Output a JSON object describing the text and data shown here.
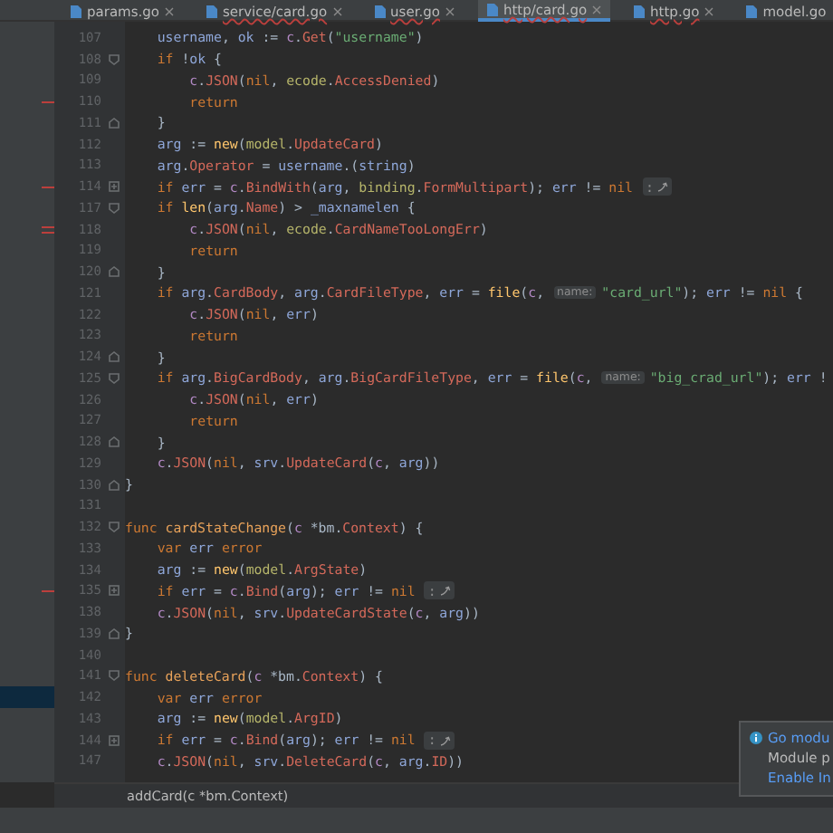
{
  "tabs": [
    {
      "label": "params.go",
      "selected": false,
      "error": false,
      "closable": true
    },
    {
      "label": "service/card.go",
      "selected": false,
      "error": true,
      "closable": true
    },
    {
      "label": "user.go",
      "selected": false,
      "error": true,
      "closable": true
    },
    {
      "label": "http/card.go",
      "selected": true,
      "error": true,
      "closable": true
    },
    {
      "label": "http.go",
      "selected": false,
      "error": true,
      "closable": true
    },
    {
      "label": "model.go",
      "selected": false,
      "error": false,
      "closable": false
    }
  ],
  "lines": [
    {
      "children": [
        {
          "number": "107",
          "kind": "plain",
          "changed": false,
          "double": false,
          "panel_selected": false,
          "segments": [
            {
              "kind": "code",
              "tokens": [
                {
                  "kind": "variable",
                  "text": "username"
                },
                {
                  "kind": "plain",
                  "text": ", "
                },
                {
                  "kind": "variable",
                  "text": "ok"
                },
                {
                  "kind": "plain",
                  "text": " := "
                },
                {
                  "kind": "param",
                  "text": "c"
                },
                {
                  "kind": "plain",
                  "text": "."
                },
                {
                  "kind": "member",
                  "text": "Get"
                },
                {
                  "kind": "plain",
                  "text": "("
                },
                {
                  "kind": "string",
                  "text": "\"username\""
                },
                {
                  "kind": "plain",
                  "text": ")"
                }
              ]
            }
          ]
        },
        {
          "number": "108",
          "kind": "fold_start",
          "changed": false,
          "double": false,
          "panel_selected": false,
          "segments": [
            {
              "kind": "code",
              "tokens": [
                {
                  "kind": "keyword",
                  "text": "if "
                },
                {
                  "kind": "plain",
                  "text": "!"
                },
                {
                  "kind": "variable",
                  "text": "ok"
                },
                {
                  "kind": "plain",
                  "text": " {"
                }
              ]
            }
          ],
          "children": [
            {
              "number": "109",
              "kind": "plain",
              "changed": false,
              "double": false,
              "panel_selected": false,
              "segments": [
                {
                  "kind": "code",
                  "tokens": [
                    {
                      "kind": "param",
                      "text": "c"
                    },
                    {
                      "kind": "plain",
                      "text": "."
                    },
                    {
                      "kind": "member",
                      "text": "JSON"
                    },
                    {
                      "kind": "plain",
                      "text": "("
                    },
                    {
                      "kind": "keyword",
                      "text": "nil"
                    },
                    {
                      "kind": "plain",
                      "text": ", "
                    },
                    {
                      "kind": "package",
                      "text": "ecode"
                    },
                    {
                      "kind": "plain",
                      "text": "."
                    },
                    {
                      "kind": "member",
                      "text": "AccessDenied"
                    },
                    {
                      "kind": "plain",
                      "text": ")"
                    }
                  ]
                }
              ]
            },
            {
              "number": "110",
              "kind": "plain",
              "changed": true,
              "double": false,
              "panel_selected": false,
              "segments": [
                {
                  "kind": "code",
                  "tokens": [
                    {
                      "kind": "keyword",
                      "text": "return"
                    }
                  ]
                }
              ]
            }
          ]
        },
        {
          "number": "111",
          "kind": "fold_end",
          "changed": false,
          "double": false,
          "panel_selected": false,
          "segments": [
            {
              "kind": "code",
              "tokens": [
                {
                  "kind": "plain",
                  "text": "}"
                }
              ]
            }
          ]
        },
        {
          "number": "112",
          "kind": "plain",
          "changed": false,
          "double": false,
          "panel_selected": false,
          "segments": [
            {
              "kind": "code",
              "tokens": [
                {
                  "kind": "variable",
                  "text": "arg"
                },
                {
                  "kind": "plain",
                  "text": " := "
                },
                {
                  "kind": "builtin",
                  "text": "new"
                },
                {
                  "kind": "plain",
                  "text": "("
                },
                {
                  "kind": "package",
                  "text": "model"
                },
                {
                  "kind": "plain",
                  "text": "."
                },
                {
                  "kind": "member",
                  "text": "UpdateCard"
                },
                {
                  "kind": "plain",
                  "text": ")"
                }
              ]
            }
          ]
        },
        {
          "number": "113",
          "kind": "plain",
          "changed": false,
          "double": false,
          "panel_selected": false,
          "segments": [
            {
              "kind": "code",
              "tokens": [
                {
                  "kind": "variable",
                  "text": "arg"
                },
                {
                  "kind": "plain",
                  "text": "."
                },
                {
                  "kind": "member",
                  "text": "Operator"
                },
                {
                  "kind": "plain",
                  "text": " = "
                },
                {
                  "kind": "variable",
                  "text": "username"
                },
                {
                  "kind": "plain",
                  "text": ".("
                },
                {
                  "kind": "variable",
                  "text": "string"
                },
                {
                  "kind": "plain",
                  "text": ")"
                }
              ]
            }
          ]
        },
        {
          "number": "114",
          "kind": "folded",
          "changed": true,
          "double": false,
          "panel_selected": false,
          "segments": [
            {
              "kind": "code",
              "tokens": [
                {
                  "kind": "keyword",
                  "text": "if "
                },
                {
                  "kind": "variable",
                  "text": "err"
                },
                {
                  "kind": "plain",
                  "text": " = "
                },
                {
                  "kind": "param",
                  "text": "c"
                },
                {
                  "kind": "plain",
                  "text": "."
                },
                {
                  "kind": "member",
                  "text": "BindWith"
                },
                {
                  "kind": "plain",
                  "text": "("
                },
                {
                  "kind": "variable",
                  "text": "arg"
                },
                {
                  "kind": "plain",
                  "text": ", "
                },
                {
                  "kind": "package",
                  "text": "binding"
                },
                {
                  "kind": "plain",
                  "text": "."
                },
                {
                  "kind": "member",
                  "text": "FormMultipart"
                },
                {
                  "kind": "plain",
                  "text": "); "
                },
                {
                  "kind": "variable",
                  "text": "err"
                },
                {
                  "kind": "plain",
                  "text": " != "
                },
                {
                  "kind": "keyword",
                  "text": "nil"
                }
              ]
            },
            {
              "kind": "fold",
              "text": ":"
            }
          ]
        },
        {
          "number": "117",
          "kind": "fold_start",
          "changed": false,
          "double": false,
          "panel_selected": false,
          "segments": [
            {
              "kind": "code",
              "tokens": [
                {
                  "kind": "keyword",
                  "text": "if "
                },
                {
                  "kind": "builtin",
                  "text": "len"
                },
                {
                  "kind": "plain",
                  "text": "("
                },
                {
                  "kind": "variable",
                  "text": "arg"
                },
                {
                  "kind": "plain",
                  "text": "."
                },
                {
                  "kind": "member",
                  "text": "Name"
                },
                {
                  "kind": "plain",
                  "text": ") > "
                },
                {
                  "kind": "variable",
                  "text": "_maxnamelen"
                },
                {
                  "kind": "plain",
                  "text": " {"
                }
              ]
            }
          ],
          "children": [
            {
              "number": "118",
              "kind": "plain",
              "changed": true,
              "double": true,
              "panel_selected": false,
              "segments": [
                {
                  "kind": "code",
                  "tokens": [
                    {
                      "kind": "param",
                      "text": "c"
                    },
                    {
                      "kind": "plain",
                      "text": "."
                    },
                    {
                      "kind": "member",
                      "text": "JSON"
                    },
                    {
                      "kind": "plain",
                      "text": "("
                    },
                    {
                      "kind": "keyword",
                      "text": "nil"
                    },
                    {
                      "kind": "plain",
                      "text": ", "
                    },
                    {
                      "kind": "package",
                      "text": "ecode"
                    },
                    {
                      "kind": "plain",
                      "text": "."
                    },
                    {
                      "kind": "member",
                      "text": "CardNameTooLongErr"
                    },
                    {
                      "kind": "plain",
                      "text": ")"
                    }
                  ]
                }
              ]
            },
            {
              "number": "119",
              "kind": "plain",
              "changed": false,
              "double": false,
              "panel_selected": false,
              "segments": [
                {
                  "kind": "code",
                  "tokens": [
                    {
                      "kind": "keyword",
                      "text": "return"
                    }
                  ]
                }
              ]
            }
          ]
        },
        {
          "number": "120",
          "kind": "fold_end",
          "changed": false,
          "double": false,
          "panel_selected": false,
          "segments": [
            {
              "kind": "code",
              "tokens": [
                {
                  "kind": "plain",
                  "text": "}"
                }
              ]
            }
          ]
        },
        {
          "number": "121",
          "kind": "plain",
          "changed": false,
          "double": false,
          "panel_selected": false,
          "segments": [
            {
              "kind": "code",
              "tokens": [
                {
                  "kind": "keyword",
                  "text": "if "
                },
                {
                  "kind": "variable",
                  "text": "arg"
                },
                {
                  "kind": "plain",
                  "text": "."
                },
                {
                  "kind": "member",
                  "text": "CardBody"
                },
                {
                  "kind": "plain",
                  "text": ", "
                },
                {
                  "kind": "variable",
                  "text": "arg"
                },
                {
                  "kind": "plain",
                  "text": "."
                },
                {
                  "kind": "member",
                  "text": "CardFileType"
                },
                {
                  "kind": "plain",
                  "text": ", "
                },
                {
                  "kind": "variable",
                  "text": "err"
                },
                {
                  "kind": "plain",
                  "text": " = "
                },
                {
                  "kind": "builtin",
                  "text": "file"
                },
                {
                  "kind": "plain",
                  "text": "("
                },
                {
                  "kind": "param",
                  "text": "c"
                },
                {
                  "kind": "plain",
                  "text": ","
                }
              ]
            },
            {
              "kind": "hint",
              "text": "name:"
            },
            {
              "kind": "code",
              "tokens": [
                {
                  "kind": "string",
                  "text": "\"card_url\""
                },
                {
                  "kind": "plain",
                  "text": "); "
                },
                {
                  "kind": "variable",
                  "text": "err"
                },
                {
                  "kind": "plain",
                  "text": " != "
                },
                {
                  "kind": "keyword",
                  "text": "nil"
                },
                {
                  "kind": "plain",
                  "text": " {"
                }
              ]
            }
          ],
          "children": [
            {
              "number": "122",
              "kind": "plain",
              "changed": false,
              "double": false,
              "panel_selected": false,
              "segments": [
                {
                  "kind": "code",
                  "tokens": [
                    {
                      "kind": "param",
                      "text": "c"
                    },
                    {
                      "kind": "plain",
                      "text": "."
                    },
                    {
                      "kind": "member",
                      "text": "JSON"
                    },
                    {
                      "kind": "plain",
                      "text": "("
                    },
                    {
                      "kind": "keyword",
                      "text": "nil"
                    },
                    {
                      "kind": "plain",
                      "text": ", "
                    },
                    {
                      "kind": "variable",
                      "text": "err"
                    },
                    {
                      "kind": "plain",
                      "text": ")"
                    }
                  ]
                }
              ]
            },
            {
              "number": "123",
              "kind": "plain",
              "changed": false,
              "double": false,
              "panel_selected": false,
              "segments": [
                {
                  "kind": "code",
                  "tokens": [
                    {
                      "kind": "keyword",
                      "text": "return"
                    }
                  ]
                }
              ]
            }
          ]
        },
        {
          "number": "124",
          "kind": "fold_end",
          "changed": false,
          "double": false,
          "panel_selected": false,
          "segments": [
            {
              "kind": "code",
              "tokens": [
                {
                  "kind": "plain",
                  "text": "}"
                }
              ]
            }
          ]
        },
        {
          "number": "125",
          "kind": "fold_start",
          "changed": false,
          "double": false,
          "panel_selected": false,
          "segments": [
            {
              "kind": "code",
              "tokens": [
                {
                  "kind": "keyword",
                  "text": "if "
                },
                {
                  "kind": "variable",
                  "text": "arg"
                },
                {
                  "kind": "plain",
                  "text": "."
                },
                {
                  "kind": "member",
                  "text": "BigCardBody"
                },
                {
                  "kind": "plain",
                  "text": ", "
                },
                {
                  "kind": "variable",
                  "text": "arg"
                },
                {
                  "kind": "plain",
                  "text": "."
                },
                {
                  "kind": "member",
                  "text": "BigCardFileType"
                },
                {
                  "kind": "plain",
                  "text": ", "
                },
                {
                  "kind": "variable",
                  "text": "err"
                },
                {
                  "kind": "plain",
                  "text": " = "
                },
                {
                  "kind": "builtin",
                  "text": "file"
                },
                {
                  "kind": "plain",
                  "text": "("
                },
                {
                  "kind": "param",
                  "text": "c"
                },
                {
                  "kind": "plain",
                  "text": ","
                }
              ]
            },
            {
              "kind": "hint",
              "text": "name:"
            },
            {
              "kind": "code",
              "tokens": [
                {
                  "kind": "string",
                  "text": "\"big_crad_url\""
                },
                {
                  "kind": "plain",
                  "text": "); "
                },
                {
                  "kind": "variable",
                  "text": "err"
                },
                {
                  "kind": "plain",
                  "text": " !"
                }
              ]
            }
          ],
          "children": [
            {
              "number": "126",
              "kind": "plain",
              "changed": false,
              "double": false,
              "panel_selected": false,
              "segments": [
                {
                  "kind": "code",
                  "tokens": [
                    {
                      "kind": "param",
                      "text": "c"
                    },
                    {
                      "kind": "plain",
                      "text": "."
                    },
                    {
                      "kind": "member",
                      "text": "JSON"
                    },
                    {
                      "kind": "plain",
                      "text": "("
                    },
                    {
                      "kind": "keyword",
                      "text": "nil"
                    },
                    {
                      "kind": "plain",
                      "text": ", "
                    },
                    {
                      "kind": "variable",
                      "text": "err"
                    },
                    {
                      "kind": "plain",
                      "text": ")"
                    }
                  ]
                }
              ]
            },
            {
              "number": "127",
              "kind": "plain",
              "changed": false,
              "double": false,
              "panel_selected": false,
              "segments": [
                {
                  "kind": "code",
                  "tokens": [
                    {
                      "kind": "keyword",
                      "text": "return"
                    }
                  ]
                }
              ]
            }
          ]
        },
        {
          "number": "128",
          "kind": "fold_end",
          "changed": false,
          "double": false,
          "panel_selected": false,
          "segments": [
            {
              "kind": "code",
              "tokens": [
                {
                  "kind": "plain",
                  "text": "}"
                }
              ]
            }
          ]
        },
        {
          "number": "129",
          "kind": "plain",
          "changed": false,
          "double": false,
          "panel_selected": false,
          "segments": [
            {
              "kind": "code",
              "tokens": [
                {
                  "kind": "param",
                  "text": "c"
                },
                {
                  "kind": "plain",
                  "text": "."
                },
                {
                  "kind": "member",
                  "text": "JSON"
                },
                {
                  "kind": "plain",
                  "text": "("
                },
                {
                  "kind": "keyword",
                  "text": "nil"
                },
                {
                  "kind": "plain",
                  "text": ", "
                },
                {
                  "kind": "variable",
                  "text": "srv"
                },
                {
                  "kind": "plain",
                  "text": "."
                },
                {
                  "kind": "member",
                  "text": "UpdateCard"
                },
                {
                  "kind": "plain",
                  "text": "("
                },
                {
                  "kind": "param",
                  "text": "c"
                },
                {
                  "kind": "plain",
                  "text": ", "
                },
                {
                  "kind": "variable",
                  "text": "arg"
                },
                {
                  "kind": "plain",
                  "text": "))"
                }
              ]
            }
          ]
        }
      ]
    },
    {
      "number": "130",
      "kind": "fold_end",
      "changed": false,
      "double": false,
      "panel_selected": false,
      "segments": [
        {
          "kind": "code",
          "tokens": [
            {
              "kind": "plain",
              "text": "}"
            }
          ]
        }
      ]
    },
    {
      "number": "131",
      "kind": "plain",
      "changed": false,
      "double": false,
      "panel_selected": false
    },
    {
      "number": "132",
      "kind": "fold_start",
      "changed": false,
      "double": false,
      "panel_selected": false,
      "segments": [
        {
          "kind": "code",
          "tokens": [
            {
              "kind": "keyword",
              "text": "func "
            },
            {
              "kind": "funcname",
              "text": "cardStateChange"
            },
            {
              "kind": "plain",
              "text": "("
            },
            {
              "kind": "param",
              "text": "c"
            },
            {
              "kind": "plain",
              "text": " *bm."
            },
            {
              "kind": "member",
              "text": "Context"
            },
            {
              "kind": "plain",
              "text": ") {"
            }
          ]
        }
      ],
      "children": [
        {
          "number": "133",
          "kind": "plain",
          "changed": false,
          "double": false,
          "panel_selected": false,
          "segments": [
            {
              "kind": "code",
              "tokens": [
                {
                  "kind": "keyword",
                  "text": "var "
                },
                {
                  "kind": "variable",
                  "text": "err "
                },
                {
                  "kind": "keyword",
                  "text": "error"
                }
              ]
            }
          ]
        },
        {
          "number": "134",
          "kind": "plain",
          "changed": false,
          "double": false,
          "panel_selected": false,
          "segments": [
            {
              "kind": "code",
              "tokens": [
                {
                  "kind": "variable",
                  "text": "arg"
                },
                {
                  "kind": "plain",
                  "text": " := "
                },
                {
                  "kind": "builtin",
                  "text": "new"
                },
                {
                  "kind": "plain",
                  "text": "("
                },
                {
                  "kind": "package",
                  "text": "model"
                },
                {
                  "kind": "plain",
                  "text": "."
                },
                {
                  "kind": "member",
                  "text": "ArgState"
                },
                {
                  "kind": "plain",
                  "text": ")"
                }
              ]
            }
          ]
        },
        {
          "number": "135",
          "kind": "folded",
          "changed": true,
          "double": false,
          "panel_selected": false,
          "segments": [
            {
              "kind": "code",
              "tokens": [
                {
                  "kind": "keyword",
                  "text": "if "
                },
                {
                  "kind": "variable",
                  "text": "err"
                },
                {
                  "kind": "plain",
                  "text": " = "
                },
                {
                  "kind": "param",
                  "text": "c"
                },
                {
                  "kind": "plain",
                  "text": "."
                },
                {
                  "kind": "member",
                  "text": "Bind"
                },
                {
                  "kind": "plain",
                  "text": "("
                },
                {
                  "kind": "variable",
                  "text": "arg"
                },
                {
                  "kind": "plain",
                  "text": "); "
                },
                {
                  "kind": "variable",
                  "text": "err"
                },
                {
                  "kind": "plain",
                  "text": " != "
                },
                {
                  "kind": "keyword",
                  "text": "nil"
                }
              ]
            },
            {
              "kind": "fold",
              "text": ":"
            }
          ]
        },
        {
          "number": "138",
          "kind": "plain",
          "changed": false,
          "double": false,
          "panel_selected": false,
          "segments": [
            {
              "kind": "code",
              "tokens": [
                {
                  "kind": "param",
                  "text": "c"
                },
                {
                  "kind": "plain",
                  "text": "."
                },
                {
                  "kind": "member",
                  "text": "JSON"
                },
                {
                  "kind": "plain",
                  "text": "("
                },
                {
                  "kind": "keyword",
                  "text": "nil"
                },
                {
                  "kind": "plain",
                  "text": ", "
                },
                {
                  "kind": "variable",
                  "text": "srv"
                },
                {
                  "kind": "plain",
                  "text": "."
                },
                {
                  "kind": "member",
                  "text": "UpdateCardState"
                },
                {
                  "kind": "plain",
                  "text": "("
                },
                {
                  "kind": "param",
                  "text": "c"
                },
                {
                  "kind": "plain",
                  "text": ", "
                },
                {
                  "kind": "variable",
                  "text": "arg"
                },
                {
                  "kind": "plain",
                  "text": "))"
                }
              ]
            }
          ]
        }
      ]
    },
    {
      "number": "139",
      "kind": "fold_end",
      "changed": false,
      "double": false,
      "panel_selected": false,
      "segments": [
        {
          "kind": "code",
          "tokens": [
            {
              "kind": "plain",
              "text": "}"
            }
          ]
        }
      ]
    },
    {
      "number": "140",
      "kind": "plain",
      "changed": false,
      "double": false,
      "panel_selected": false
    },
    {
      "number": "141",
      "kind": "fold_start",
      "changed": false,
      "double": false,
      "panel_selected": false,
      "segments": [
        {
          "kind": "code",
          "tokens": [
            {
              "kind": "keyword",
              "text": "func "
            },
            {
              "kind": "funcname",
              "text": "deleteCard"
            },
            {
              "kind": "plain",
              "text": "("
            },
            {
              "kind": "param",
              "text": "c"
            },
            {
              "kind": "plain",
              "text": " *bm."
            },
            {
              "kind": "member",
              "text": "Context"
            },
            {
              "kind": "plain",
              "text": ") {"
            }
          ]
        }
      ],
      "children": [
        {
          "number": "142",
          "kind": "plain",
          "changed": false,
          "double": false,
          "panel_selected": true,
          "segments": [
            {
              "kind": "code",
              "tokens": [
                {
                  "kind": "keyword",
                  "text": "var "
                },
                {
                  "kind": "variable",
                  "text": "err "
                },
                {
                  "kind": "keyword",
                  "text": "error"
                }
              ]
            }
          ]
        },
        {
          "number": "143",
          "kind": "plain",
          "changed": false,
          "double": false,
          "panel_selected": false,
          "segments": [
            {
              "kind": "code",
              "tokens": [
                {
                  "kind": "variable",
                  "text": "arg"
                },
                {
                  "kind": "plain",
                  "text": " := "
                },
                {
                  "kind": "builtin",
                  "text": "new"
                },
                {
                  "kind": "plain",
                  "text": "("
                },
                {
                  "kind": "package",
                  "text": "model"
                },
                {
                  "kind": "plain",
                  "text": "."
                },
                {
                  "kind": "member",
                  "text": "ArgID"
                },
                {
                  "kind": "plain",
                  "text": ")"
                }
              ]
            }
          ]
        },
        {
          "number": "144",
          "kind": "folded",
          "changed": false,
          "double": false,
          "panel_selected": false,
          "segments": [
            {
              "kind": "code",
              "tokens": [
                {
                  "kind": "keyword",
                  "text": "if "
                },
                {
                  "kind": "variable",
                  "text": "err"
                },
                {
                  "kind": "plain",
                  "text": " = "
                },
                {
                  "kind": "param",
                  "text": "c"
                },
                {
                  "kind": "plain",
                  "text": "."
                },
                {
                  "kind": "member",
                  "text": "Bind"
                },
                {
                  "kind": "plain",
                  "text": "("
                },
                {
                  "kind": "variable",
                  "text": "arg"
                },
                {
                  "kind": "plain",
                  "text": "); "
                },
                {
                  "kind": "variable",
                  "text": "err"
                },
                {
                  "kind": "plain",
                  "text": " != "
                },
                {
                  "kind": "keyword",
                  "text": "nil"
                }
              ]
            },
            {
              "kind": "fold",
              "text": ":"
            }
          ]
        },
        {
          "number": "147",
          "kind": "plain",
          "changed": false,
          "double": false,
          "panel_selected": false,
          "segments": [
            {
              "kind": "code",
              "tokens": [
                {
                  "kind": "param",
                  "text": "c"
                },
                {
                  "kind": "plain",
                  "text": "."
                },
                {
                  "kind": "member",
                  "text": "JSON"
                },
                {
                  "kind": "plain",
                  "text": "("
                },
                {
                  "kind": "keyword",
                  "text": "nil"
                },
                {
                  "kind": "plain",
                  "text": ", "
                },
                {
                  "kind": "variable",
                  "text": "srv"
                },
                {
                  "kind": "plain",
                  "text": "."
                },
                {
                  "kind": "member",
                  "text": "DeleteCard"
                },
                {
                  "kind": "plain",
                  "text": "("
                },
                {
                  "kind": "param",
                  "text": "c"
                },
                {
                  "kind": "plain",
                  "text": ", "
                },
                {
                  "kind": "variable",
                  "text": "arg"
                },
                {
                  "kind": "plain",
                  "text": "."
                },
                {
                  "kind": "member",
                  "text": "ID"
                },
                {
                  "kind": "plain",
                  "text": "))"
                }
              ]
            }
          ]
        }
      ]
    }
  ],
  "breadcrumb": "addCard(c *bm.Context)",
  "notification": {
    "title": "Go modu",
    "message": "Module p",
    "link": "Enable In"
  }
}
